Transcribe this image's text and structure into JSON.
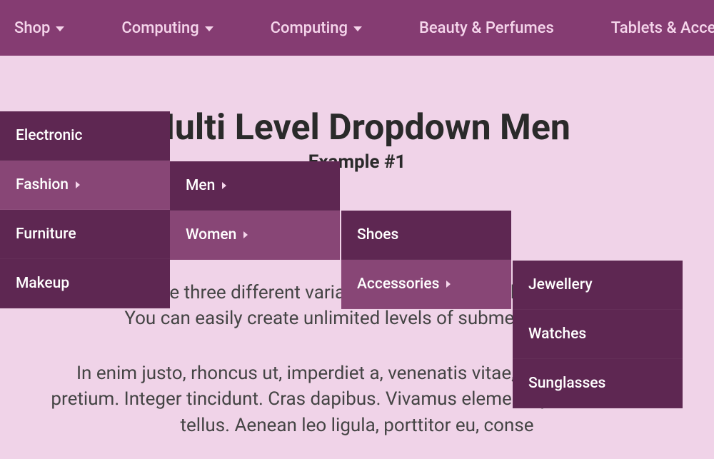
{
  "navbar": {
    "items": [
      {
        "label": "Shop",
        "hasDropdown": true
      },
      {
        "label": "Computing",
        "hasDropdown": true
      },
      {
        "label": "Computing",
        "hasDropdown": true
      },
      {
        "label": "Beauty & Perfumes",
        "hasDropdown": false
      },
      {
        "label": "Tablets & Accessorie",
        "hasDropdown": false
      }
    ]
  },
  "dropdown": {
    "level1": [
      {
        "label": "Electronic",
        "hasSub": false
      },
      {
        "label": "Fashion",
        "hasSub": true,
        "hovered": true
      },
      {
        "label": "Furniture",
        "hasSub": false
      },
      {
        "label": "Makeup",
        "hasSub": false
      }
    ],
    "level2": [
      {
        "label": "Men",
        "hasSub": true
      },
      {
        "label": "Women",
        "hasSub": true,
        "hovered": true
      }
    ],
    "level3": [
      {
        "label": "Shoes",
        "hasSub": false
      },
      {
        "label": "Accessories",
        "hasSub": true,
        "hovered": true
      }
    ],
    "level4": [
      {
        "label": "Jewellery",
        "hasSub": false
      },
      {
        "label": "Watches",
        "hasSub": false
      },
      {
        "label": "Sunglasses",
        "hasSub": false
      }
    ]
  },
  "content": {
    "title": "Multi Level Dropdown Men",
    "subtitle": "Example #1",
    "paragraph1": "We have make three different variation and each have three levels Menu. You can easily create unlimited levels of submenu and ...",
    "paragraph2": "In enim justo, rhoncus ut, imperdiet a, venenatis vitae, justo. N mollis pretium. Integer tincidunt. Cras dapibus. Vivamus eleme vulputate eleifend tellus. Aenean leo ligula, porttitor eu, conse"
  }
}
